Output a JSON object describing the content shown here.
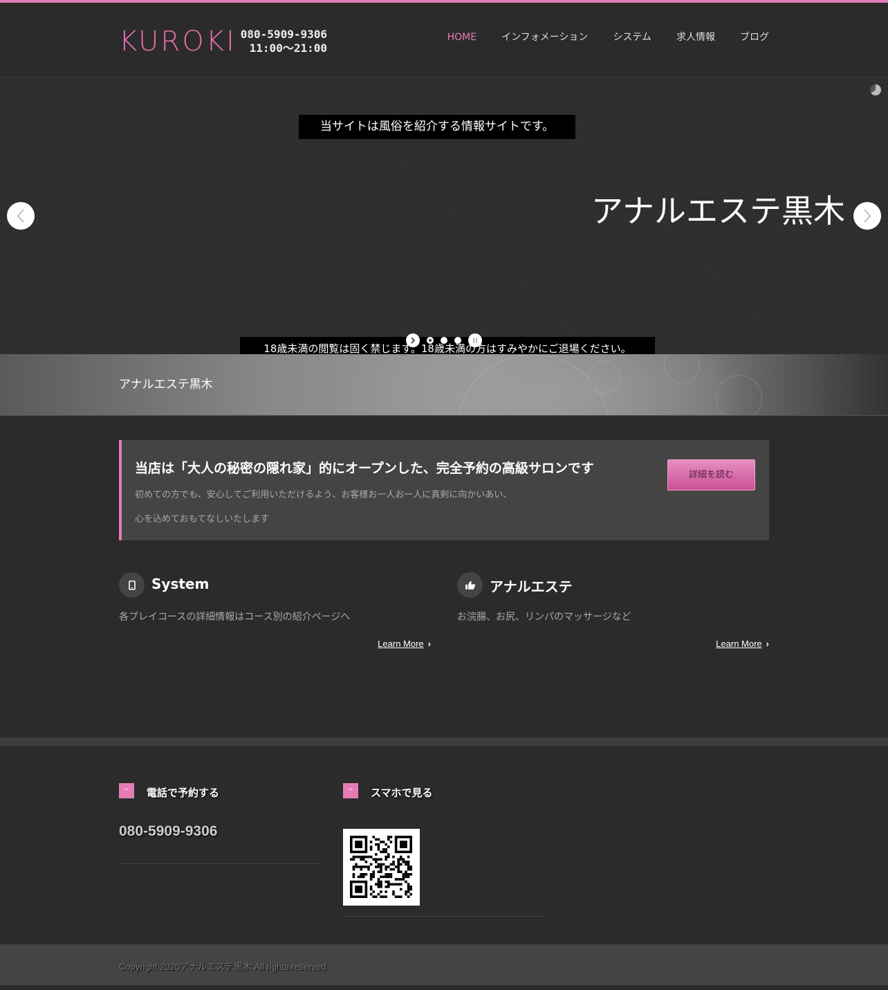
{
  "header": {
    "logo": "KUROKI",
    "phone": "080-5909-9306",
    "hours": "11:00〜21:00",
    "nav": [
      {
        "label": "HOME",
        "active": true
      },
      {
        "label": "インフォメーション"
      },
      {
        "label": "システム"
      },
      {
        "label": "求人情報"
      },
      {
        "label": "ブログ"
      }
    ]
  },
  "slider": {
    "caption_top": "当サイトは風俗を紹介する情報サイトです。",
    "title": "アナルエステ黒木",
    "caption_bottom": "18歳未満の閲覧は固く禁じます。18歳未満の方はすみやかにご退場ください。",
    "current_slide": 1,
    "slide_count": 3
  },
  "banner": {
    "title": "アナルエステ黒木"
  },
  "callout": {
    "heading": "当店は「大人の秘密の隠れ家」的にオープンした、完全予約の高級サロンです",
    "text_line1": "初めての方でも、安心してご利用いただけるよう、お客様お一人お一人に真剣に向かいあい、",
    "text_line2": "心を込めておもてなしいたします",
    "button": "詳細を読む"
  },
  "features": [
    {
      "icon": "tablet-icon",
      "title": "System",
      "text": "各プレイコースの詳細情報はコース別の紹介ページへ",
      "link": "Learn More"
    },
    {
      "icon": "thumbs-up-icon",
      "title": "アナルエステ",
      "text": "お浣腸、お尻、リンパのマッサージなど",
      "link": "Learn More"
    }
  ],
  "footer": {
    "widgets": [
      {
        "title": "電話で予約する",
        "phone": "080-5909-9306"
      },
      {
        "title": "スマホで見る",
        "qr": "qr-code"
      }
    ],
    "copyright": "Copyright 2020アナルエステ黒木 All rights reserved"
  },
  "colors": {
    "accent": "#e37cb5",
    "background": "#2b2b2b",
    "panel": "#444444"
  }
}
